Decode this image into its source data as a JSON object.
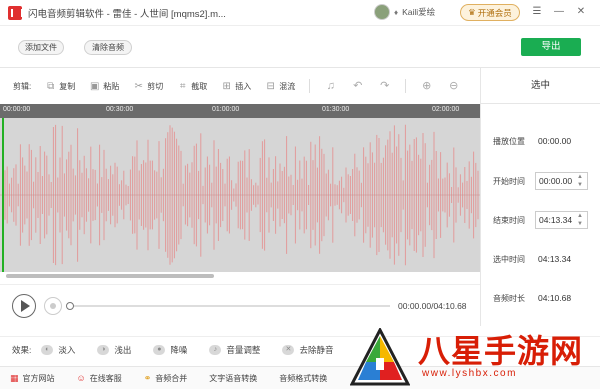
{
  "window": {
    "title": "闪电音频剪辑软件 - 雷佳 - 人世间 [mqms2].m...",
    "user_name": "Kaili爱绘",
    "member_button": "开通会员"
  },
  "toolbar_top": {
    "add_file": "添加文件",
    "clear_audio": "清除音频",
    "export": "导出"
  },
  "toolbar_edit": {
    "label": "剪辑:",
    "items": [
      "复制",
      "粘贴",
      "剪切",
      "截取",
      "插入",
      "混流"
    ]
  },
  "timeline": {
    "ticks": [
      "00:00:00",
      "00:30:00",
      "01:00:00",
      "01:30:00",
      "02:00:00"
    ]
  },
  "player": {
    "time": "00:00.00/04:10.68"
  },
  "selection_panel": {
    "title": "选中",
    "play_position_label": "播放位置",
    "play_position": "00:00.00",
    "start_label": "开始时间",
    "start": "00:00.00",
    "end_label": "结束时间",
    "end": "04:13.34",
    "selected_length_label": "选中时间",
    "selected_length": "04:13.34",
    "audio_length_label": "音频时长",
    "audio_length": "04:10.68"
  },
  "effects": {
    "label": "效果:",
    "items": [
      "淡入",
      "浅出",
      "降噪",
      "音量调整",
      "去除静音"
    ]
  },
  "bottom_bar": {
    "items": [
      "官方网站",
      "在线客服",
      "音频合并",
      "文字语音转换",
      "音频格式转换"
    ]
  },
  "watermark": {
    "text": "八星手游网",
    "url": "www.lyshbx.com"
  },
  "colors": {
    "accent_green": "#1aad52",
    "waveform": "#e29a9a",
    "ruler": "#6b6b6b",
    "watermark_red": "#d81e06"
  }
}
